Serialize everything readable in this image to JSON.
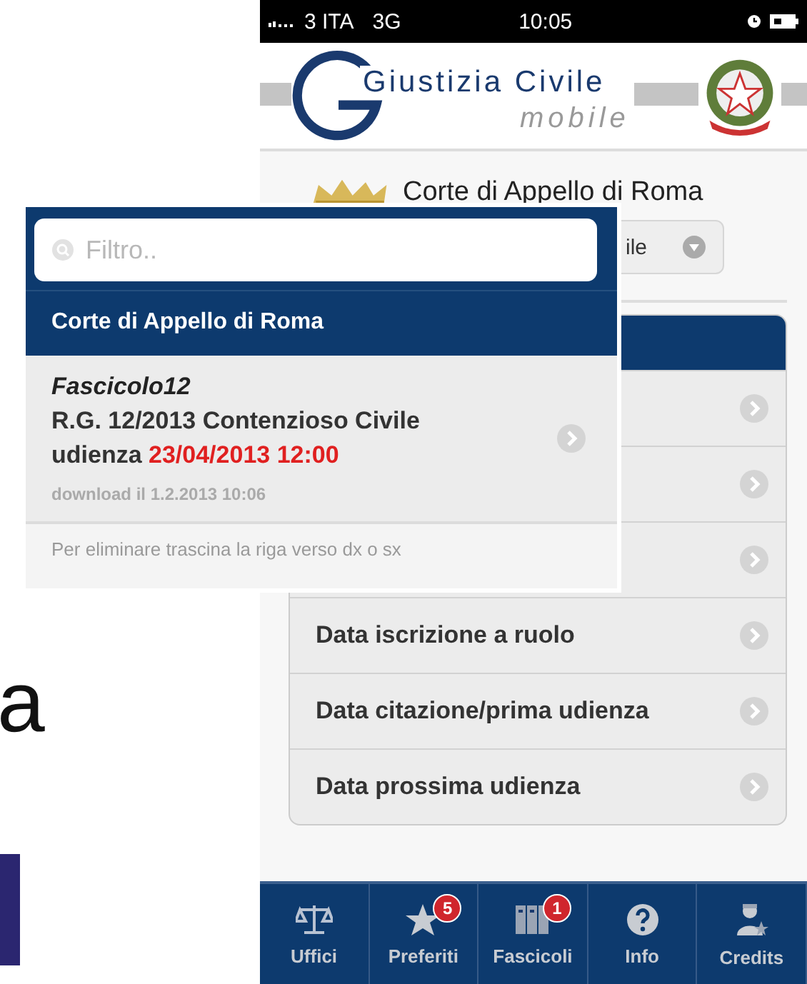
{
  "slide": {
    "letter": "a"
  },
  "phone": {
    "status_bar": {
      "carrier": "3 ITA",
      "network": "3G",
      "time": "10:05"
    },
    "logo": {
      "title": "Giustizia Civile",
      "subtitle": "mobile"
    },
    "office": "Corte di Appello di Roma",
    "dropdown": {
      "value": "ile"
    },
    "list": [
      {
        "kind": "covered"
      },
      {
        "kind": "covered"
      },
      {
        "kind": "covered"
      },
      {
        "kind": "labeled",
        "label": "Data iscrizione a ruolo"
      },
      {
        "kind": "labeled",
        "label": "Data citazione/prima udienza"
      },
      {
        "kind": "labeled",
        "label": "Data prossima udienza"
      }
    ],
    "tabs": [
      {
        "kind": "scales",
        "label": "Uffici"
      },
      {
        "kind": "star",
        "label": "Preferiti",
        "badge": "5"
      },
      {
        "kind": "folders",
        "label": "Fascicoli",
        "badge": "1"
      },
      {
        "kind": "help",
        "label": "Info"
      },
      {
        "kind": "person",
        "label": "Credits"
      }
    ]
  },
  "panel": {
    "search": {
      "placeholder": "Filtro.."
    },
    "header": "Corte di Appello di Roma",
    "item": {
      "title": "Fascicolo12",
      "case": "R.G. 12/2013 Contenzioso Civile",
      "hearing_label": "udienza",
      "hearing_date": "23/04/2013 12:00",
      "download": "download il 1.2.2013 10:06"
    },
    "hint": "Per eliminare trascina la riga verso dx o sx"
  }
}
